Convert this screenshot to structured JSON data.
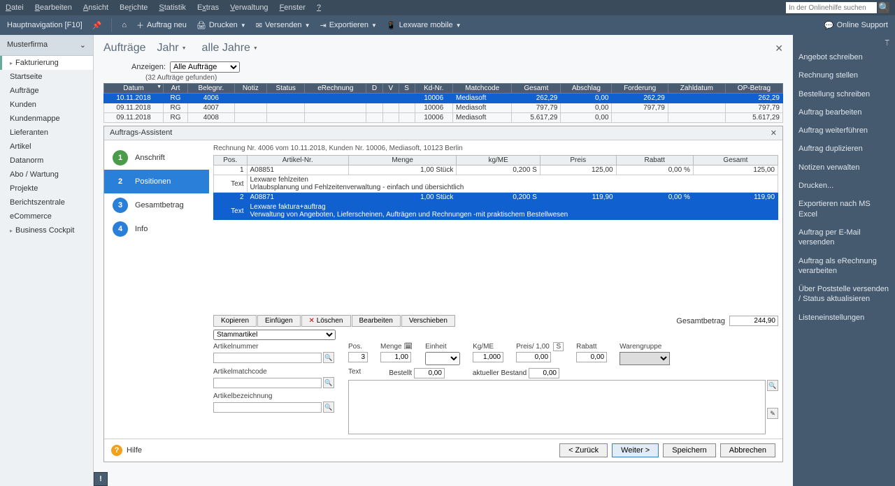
{
  "menubar": {
    "items": [
      "Datei",
      "Bearbeiten",
      "Ansicht",
      "Berichte",
      "Statistik",
      "Extras",
      "Verwaltung",
      "Fenster",
      "?"
    ],
    "search_placeholder": "In der Onlinehilfe suchen"
  },
  "toolbar": {
    "nav_label": "Hauptnavigation [F10]",
    "auftrag_neu": "Auftrag neu",
    "drucken": "Drucken",
    "versenden": "Versenden",
    "exportieren": "Exportieren",
    "lexware_mobile": "Lexware mobile",
    "support": "Online Support"
  },
  "sidebar": {
    "firm": "Musterfirma",
    "items": [
      {
        "label": "Fakturierung",
        "active": true,
        "parent": true
      },
      {
        "label": "Startseite"
      },
      {
        "label": "Aufträge"
      },
      {
        "label": "Kunden"
      },
      {
        "label": "Kundenmappe"
      },
      {
        "label": "Lieferanten"
      },
      {
        "label": "Artikel"
      },
      {
        "label": "Datanorm"
      },
      {
        "label": "Abo / Wartung"
      },
      {
        "label": "Projekte"
      },
      {
        "label": "Berichtszentrale"
      },
      {
        "label": "eCommerce"
      },
      {
        "label": "Business Cockpit",
        "parent": true
      }
    ]
  },
  "page": {
    "title": "Aufträge",
    "year_label": "Jahr",
    "year_value": "alle Jahre",
    "show_label": "Anzeigen:",
    "show_value": "Alle Aufträge",
    "count": "(32 Aufträge gefunden)"
  },
  "grid": {
    "headers": [
      "Datum",
      "Art",
      "Belegnr.",
      "Notiz",
      "Status",
      "eRechnung",
      "D",
      "V",
      "S",
      "Kd-Nr.",
      "Matchcode",
      "Gesamt",
      "Abschlag",
      "Forderung",
      "Zahldatum",
      "OP-Betrag"
    ],
    "rows": [
      {
        "selected": true,
        "cells": [
          "10.11.2018",
          "RG",
          "4006",
          "",
          "",
          "",
          "",
          "",
          "",
          "10006",
          "Mediasoft",
          "262,29",
          "0,00",
          "262,29",
          "",
          "262,29"
        ]
      },
      {
        "cells": [
          "09.11.2018",
          "RG",
          "4007",
          "",
          "",
          "",
          "",
          "",
          "",
          "10006",
          "Mediasoft",
          "797,79",
          "0,00",
          "797,79",
          "",
          "797,79"
        ]
      },
      {
        "cells": [
          "09.11.2018",
          "RG",
          "4008",
          "",
          "",
          "",
          "",
          "",
          "",
          "10006",
          "Mediasoft",
          "5.617,29",
          "0,00",
          "",
          "",
          "5.617,29"
        ]
      }
    ]
  },
  "wizard": {
    "title": "Auftrags-Assistent",
    "doc_title": "Rechnung Nr. 4006 vom 10.11.2018, Kunden Nr. 10006, Mediasoft, 10123 Berlin",
    "steps": [
      {
        "num": "1",
        "label": "Anschrift",
        "done": true
      },
      {
        "num": "2",
        "label": "Positionen",
        "active": true
      },
      {
        "num": "3",
        "label": "Gesamtbetrag"
      },
      {
        "num": "4",
        "label": "Info"
      }
    ],
    "line_headers": [
      "Pos.",
      "Artikel-Nr.",
      "Menge",
      "kg/ME",
      "Preis",
      "Rabatt",
      "Gesamt"
    ],
    "lines": [
      {
        "pos": "1",
        "art": "A08851",
        "menge": "1,00 Stück",
        "kgme": "0,200",
        "s": "S",
        "preis": "125,00",
        "rabatt": "0,00 %",
        "gesamt": "125,00",
        "text_label": "Text",
        "text1": "Lexware fehlzeiten",
        "text2": "Urlaubsplanung und Fehlzeitenverwaltung - einfach und übersichtlich"
      },
      {
        "selected": true,
        "pos": "2",
        "art": "A08871",
        "menge": "1,00 Stück",
        "kgme": "0,200",
        "s": "S",
        "preis": "119,90",
        "rabatt": "0,00 %",
        "gesamt": "119,90",
        "text_label": "Text",
        "text1": "Lexware faktura+auftrag",
        "text2": "Verwaltung von Angeboten, Lieferscheinen, Aufträgen und Rechnungen -mit praktischem Bestellwesen"
      }
    ],
    "actions": {
      "kopieren": "Kopieren",
      "einfuegen": "Einfügen",
      "loeschen": "Löschen",
      "bearbeiten": "Bearbeiten",
      "verschieben": "Verschieben"
    },
    "total_label": "Gesamtbetrag",
    "total_value": "244,90",
    "form": {
      "stammartikel": "Stammartikel",
      "labels": {
        "artikelnummer": "Artikelnummer",
        "pos": "Pos.",
        "menge": "Menge",
        "einheit": "Einheit",
        "kgme": "Kg/ME",
        "preis": "Preis/ 1,00",
        "s": "S",
        "rabatt": "Rabatt",
        "warengruppe": "Warengruppe",
        "artikelmatchcode": "Artikelmatchcode",
        "text": "Text",
        "bestellt": "Bestellt",
        "bestand": "aktueller Bestand",
        "artikelbezeichnung": "Artikelbezeichnung"
      },
      "values": {
        "pos": "3",
        "menge": "1,00",
        "kgme": "1,000",
        "preis": "0,00",
        "rabatt": "0,00",
        "bestellt": "0,00",
        "bestand": "0,00"
      }
    },
    "footer": {
      "hilfe": "Hilfe",
      "zurueck": "< Zurück",
      "weiter": "Weiter >",
      "speichern": "Speichern",
      "abbrechen": "Abbrechen"
    }
  },
  "taskpanel": {
    "items": [
      "Angebot schreiben",
      "Rechnung stellen",
      "Bestellung schreiben",
      "Auftrag bearbeiten",
      "Auftrag weiterführen",
      "Auftrag duplizieren",
      "Notizen verwalten",
      "Drucken...",
      "Exportieren nach MS Excel",
      "Auftrag per E-Mail versenden",
      "Auftrag als eRechnung verarbeiten",
      "Über Poststelle versenden / Status aktualisieren",
      "Listeneinstellungen"
    ]
  }
}
